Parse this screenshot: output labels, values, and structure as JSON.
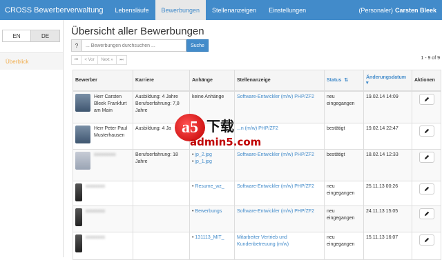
{
  "navbar": {
    "brand": "CROSS Bewerberverwaltung",
    "links": [
      "Lebensläufe",
      "Bewerbungen",
      "Stellenanzeigen",
      "Einstellungen"
    ],
    "active_index": 1,
    "user_role": "(Personaler)",
    "user_name": "Carsten Bleek"
  },
  "sidebar": {
    "lang_en": "EN",
    "lang_de": "DE",
    "overview": "Überblick"
  },
  "main": {
    "title": "Übersicht aller Bewerbungen",
    "search_help": "?",
    "search_placeholder": "... Bewerbungen durchsuchen ...",
    "search_button": "Suche",
    "pager": {
      "first": "⏮",
      "prev": "< Vor",
      "next": "Next »",
      "last": "⏭"
    },
    "page_count": "1 - 9 of 9"
  },
  "table": {
    "headers": {
      "applicant": "Bewerber",
      "career": "Karriere",
      "attachments": "Anhänge",
      "job": "Stellenanzeige",
      "status": "Status",
      "modified": "Änderungsdatum",
      "actions": "Aktionen"
    },
    "rows": [
      {
        "name": "Herr Carsten Bleek Frankfurt am Main",
        "career": "Ausbildung: 4 Jahre Berufserfahrung: 7,8 Jahre",
        "attachments": "keine Anhänge",
        "job": "Software-Entwickler (m/w) PHP/ZF2",
        "status": "neu eingegangen",
        "date": "19.02.14 14:09"
      },
      {
        "name": "Herr Peter Paul Musterhausen",
        "career": "Ausbildung: 4 Ja",
        "attachments": "",
        "job": "...n (m/w) PHP/ZF2",
        "status": "bestätigt",
        "date": "19.02.14 22:47"
      },
      {
        "name": "xxxxxxxxx",
        "career": "Berufserfahrung: 18 Jahre",
        "attachments": [
          "jp_2.jpg",
          "jp_1.jpg"
        ],
        "job": "Software-Entwickler (m/w) PHP/ZF2",
        "status": "bestätigt",
        "date": "18.02.14 12:33"
      },
      {
        "name": "xxxxxxxx",
        "career": "",
        "attachments": [
          "Resume_wz_"
        ],
        "job": "Software-Entwickler (m/w) PHP/ZF2",
        "status": "neu eingegangen",
        "date": "25.11.13 00:26"
      },
      {
        "name": "xxxxxxxx",
        "career": "",
        "attachments": [
          "Bewerbungs"
        ],
        "job": "Software-Entwickler (m/w) PHP/ZF2",
        "status": "neu eingegangen",
        "date": "24.11.13 15:05"
      },
      {
        "name": "xxxxxxxx",
        "career": "",
        "attachments": [
          "131113_MIT_"
        ],
        "job": "Mitarbeiter Vertrieb und Kundenbetreuung (m/w)",
        "status": "neu eingegangen",
        "date": "15.11.13 16:07"
      }
    ]
  },
  "watermark": {
    "logo_text": "a5",
    "title": "下载",
    "url": "admin5.com"
  }
}
